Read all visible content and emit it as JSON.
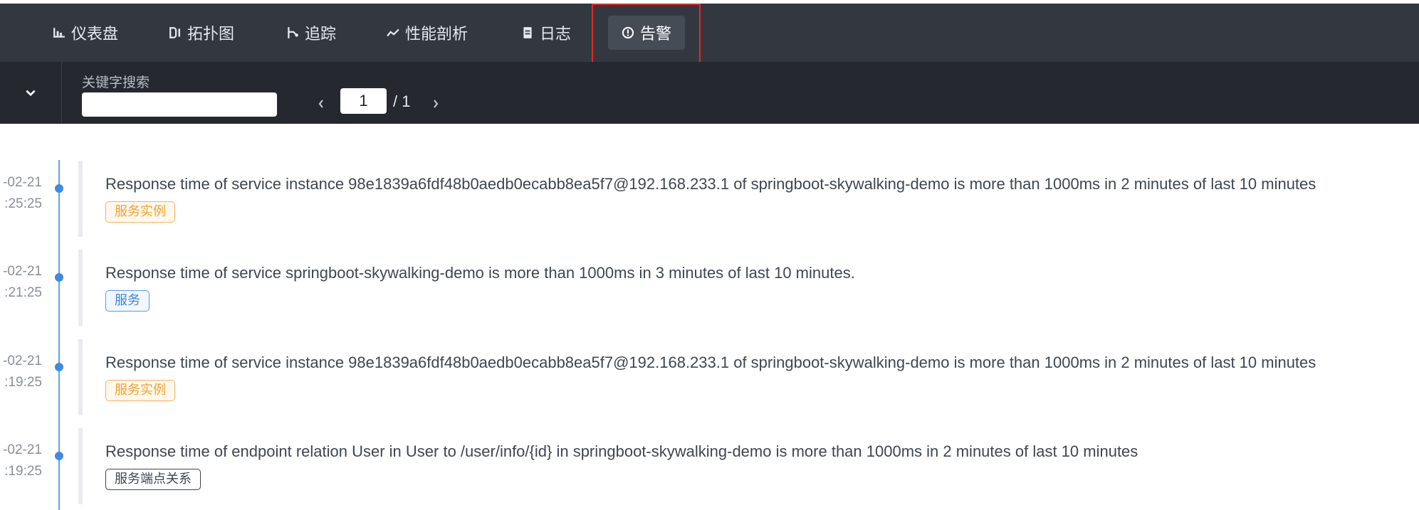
{
  "nav": {
    "items": [
      {
        "label": "仪表盘",
        "icon": "dashboard-icon"
      },
      {
        "label": "拓扑图",
        "icon": "topology-icon"
      },
      {
        "label": "追踪",
        "icon": "trace-icon"
      },
      {
        "label": "性能剖析",
        "icon": "profile-icon"
      },
      {
        "label": "日志",
        "icon": "log-icon"
      },
      {
        "label": "告警",
        "icon": "alarm-icon",
        "active": true
      }
    ],
    "highlight_color": "#e22a2a"
  },
  "toolbar": {
    "search_label": "关键字搜索",
    "search_value": "",
    "page_current": "1",
    "page_total": "/ 1"
  },
  "alarms": [
    {
      "date": "-02-21",
      "time": ":25:25",
      "message": "Response time of service instance 98e1839a6fdf48b0aedb0ecabb8ea5f7@192.168.233.1 of springboot-skywalking-demo is more than 1000ms in 2 minutes of last 10 minutes",
      "tag": "服务实例",
      "tag_type": "instance"
    },
    {
      "date": "-02-21",
      "time": ":21:25",
      "message": "Response time of service springboot-skywalking-demo is more than 1000ms in 3 minutes of last 10 minutes.",
      "tag": "服务",
      "tag_type": "service"
    },
    {
      "date": "-02-21",
      "time": ":19:25",
      "message": "Response time of service instance 98e1839a6fdf48b0aedb0ecabb8ea5f7@192.168.233.1 of springboot-skywalking-demo is more than 1000ms in 2 minutes of last 10 minutes",
      "tag": "服务实例",
      "tag_type": "instance"
    },
    {
      "date": "-02-21",
      "time": ":19:25",
      "message": "Response time of endpoint relation User in User to /user/info/{id} in springboot-skywalking-demo is more than 1000ms in 2 minutes of last 10 minutes",
      "tag": "服务端点关系",
      "tag_type": "relation"
    }
  ],
  "colors": {
    "nav_bg": "#333840",
    "toolbar_bg": "#25292f",
    "timeline": "#3d8be0",
    "tag_instance": "#f5a030",
    "tag_service": "#3d84de",
    "tag_relation": "#3f4650"
  }
}
